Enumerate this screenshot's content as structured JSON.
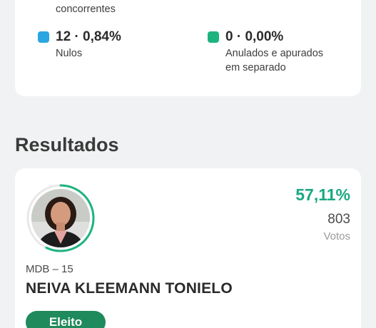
{
  "summary": {
    "partial_label": "concorrentes",
    "nulos": {
      "value": "12 · 0,84%",
      "label": "Nulos",
      "color": "#2ba6e1"
    },
    "anulados": {
      "value": "0 · 0,00%",
      "label_line1": "Anulados e apurados",
      "label_line2": "em separado",
      "color": "#1db37f"
    }
  },
  "results": {
    "title": "Resultados",
    "candidate": {
      "percentage": "57,11%",
      "votes": "803",
      "votes_label": "Votos",
      "party": "MDB – 15",
      "name": "NEIVA KLEEMANN TONIELO",
      "status": "Eleito",
      "vote_share": 0.5711,
      "ring_color": "#1db37f",
      "badge_color": "#1f8a5b"
    }
  }
}
